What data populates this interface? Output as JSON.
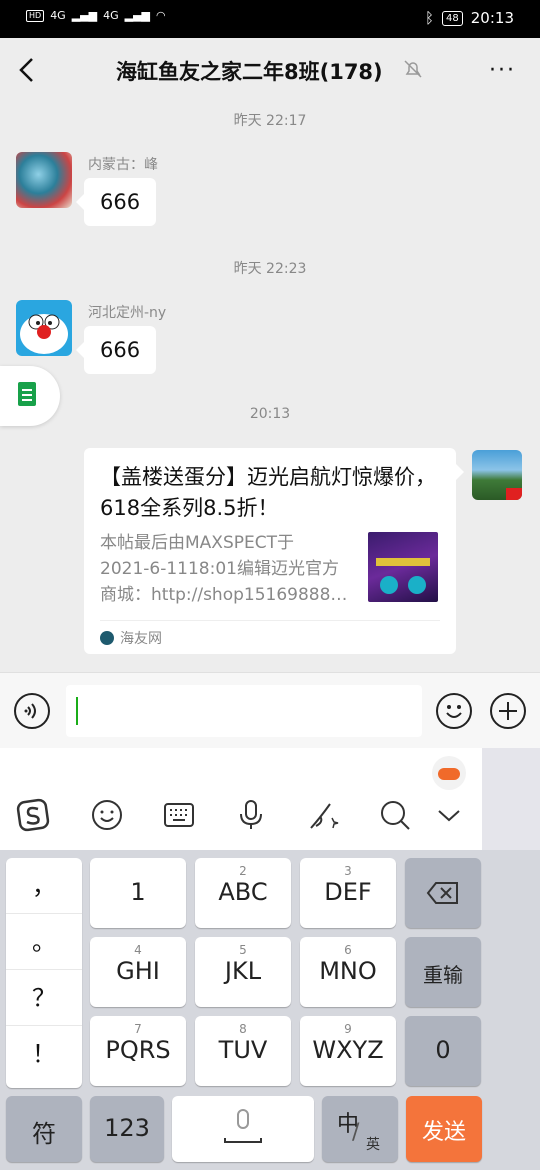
{
  "status_bar": {
    "left_indicators": [
      "HD",
      "4G",
      "4G"
    ],
    "battery": "48",
    "time": "20:13"
  },
  "header": {
    "title": "海缸鱼友之家二年8班(178)",
    "more": "···"
  },
  "chat": {
    "messages": [
      {
        "time": "昨天 22:17",
        "sender": "内蒙古：峰",
        "text": "666"
      },
      {
        "time": "昨天 22:23",
        "sender": "河北定州-ny",
        "text": "666"
      }
    ],
    "time3": "20:13",
    "card": {
      "title": "【盖楼送蛋分】迈光启航灯惊爆价，618全系列8.5折！",
      "desc_lines": [
        "本帖最后由MAXSPECT于",
        "2021-6-1118:01编辑迈光官方",
        "商城：http://shop15169888…"
      ],
      "source": "海友网"
    }
  },
  "keyboard": {
    "punct": [
      "，",
      "。",
      "？",
      "！"
    ],
    "row1": [
      {
        "sub": "",
        "main": "1"
      },
      {
        "sub": "2",
        "main": "ABC"
      },
      {
        "sub": "3",
        "main": "DEF"
      }
    ],
    "row2": [
      {
        "sub": "4",
        "main": "GHI"
      },
      {
        "sub": "5",
        "main": "JKL"
      },
      {
        "sub": "6",
        "main": "MNO"
      }
    ],
    "row3": [
      {
        "sub": "7",
        "main": "PQRS"
      },
      {
        "sub": "8",
        "main": "TUV"
      },
      {
        "sub": "9",
        "main": "WXYZ"
      }
    ],
    "reenter": "重输",
    "zero": "0",
    "symbol": "符",
    "num": "123",
    "lang_main": "中",
    "lang_sub": "英",
    "send": "发送"
  },
  "colors": {
    "accent_green": "#1aad19",
    "send_orange": "#f4743b"
  },
  "icons": [
    "back-icon",
    "mute-bell-icon",
    "voice-icon",
    "emoji-icon",
    "plus-icon",
    "sogou-logo-icon",
    "smiley-icon",
    "keyboard-icon",
    "mic-icon",
    "handwrite-icon",
    "search-icon",
    "chevron-down-icon",
    "backspace-icon"
  ]
}
